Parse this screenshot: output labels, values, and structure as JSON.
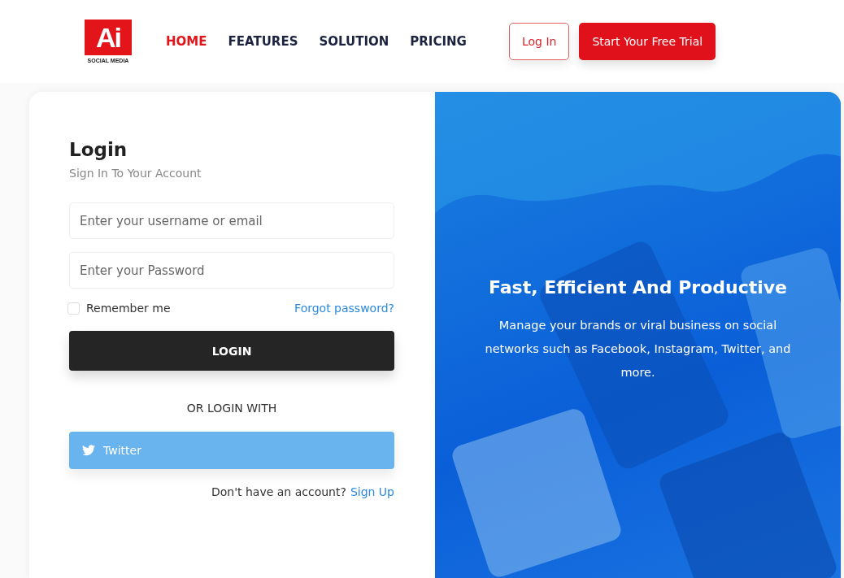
{
  "header": {
    "logo": {
      "mark": "Ai",
      "caption": "SOCIAL MEDIA"
    },
    "nav": [
      {
        "label": "HOME",
        "selected": true
      },
      {
        "label": "FEATURES",
        "selected": false
      },
      {
        "label": "SOLUTION",
        "selected": false
      },
      {
        "label": "PRICING",
        "selected": false
      }
    ],
    "login_button": "Log In",
    "trial_button": "Start Your Free Trial"
  },
  "login_form": {
    "title": "Login",
    "subtitle": "Sign In To Your Account",
    "username": {
      "placeholder": "Enter your username or email"
    },
    "password": {
      "placeholder": "Enter your Password"
    },
    "remember": {
      "label": "Remember me",
      "checked": false
    },
    "forgot_link": "Forgot password?",
    "submit": "LOGIN",
    "divider": "OR LOGIN WITH",
    "social_button": "Twitter",
    "signup_prompt": "Don't have an account?",
    "signup_link": "Sign Up"
  },
  "promo": {
    "title": "Fast, Efficient And Productive",
    "text": "Manage your brands or viral business on social networks such as Facebook, Instagram, Twitter, and more."
  }
}
